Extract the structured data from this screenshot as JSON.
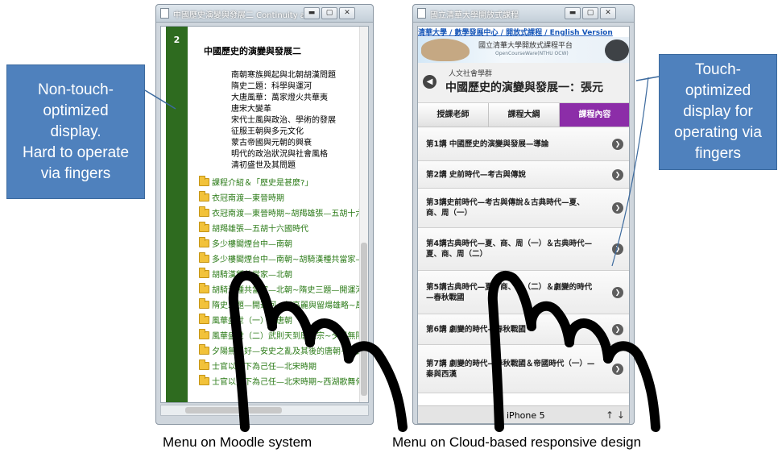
{
  "moodle_window": {
    "title": "中國歷史演變與發展二 Continuity an...",
    "topic_number": "2",
    "topic_title": "中國歷史的演變與發展二",
    "subtopics": [
      "南朝寒族興起與北朝胡漢問題",
      "隋史二題：科學與運河",
      "大唐風華：萬家燈火共華夷",
      "唐宋大變革",
      "宋代士風與政治、學術的發展",
      "征服王朝與多元文化",
      "蒙古帝國與元朝的興衰",
      "明代的政治狀況與社會風格",
      "清初盛世及其問題"
    ],
    "resources": [
      "課程介紹＆「歷史是甚麼?」",
      "衣冠南渡—東晉時期",
      "衣冠南渡—東晉時期~胡羯雄張—五胡十六國",
      "胡羯雄張—五胡十六國時代",
      "多少樓閣煙台中—南朝",
      "多少樓閣煙台中—南朝~胡騎漢種共當家—北",
      "胡騎漢種共當家—北朝",
      "胡騎漢種共當家—北朝~隋史三題—開運河、",
      "隋史三題—開運河、征高麗與留煬雄略~風華",
      "風華盛世（一）—唐朝",
      "風華盛世（二）武則天到唐玄宗~夕陽無限",
      "夕陽無限好—安史之亂及其後的唐朝~士官以",
      "士官以天下為己任—北宋時期",
      "士官以天下為己任—北宋時期~西湖歌舞何時"
    ]
  },
  "cloud_window": {
    "title": "國立清華大學開放式課程",
    "nav_links": "清華大學 / 數學發展中心 / 開放式課程 / English Version",
    "banner_text": "國立清華大學開放式課程平台",
    "banner_sub": "OpenCourseWare(NTHU OCW)",
    "category": "人文社會學群",
    "course_title": "中國歷史的演變與發展一：張元",
    "tabs": [
      {
        "label": "授課老師",
        "active": false
      },
      {
        "label": "課程大綱",
        "active": false
      },
      {
        "label": "課程內容",
        "active": true
      }
    ],
    "lessons": [
      "第1講 中國歷史的演變與發展—導論",
      "第2講 史前時代—考古與傳說",
      "第3講史前時代—考古與傳說＆古典時代—夏、商、周（一）",
      "第4講古典時代—夏、商、周（一）＆古典時代—夏、商、周（二）",
      "第5講古典時代—夏、商、周（二）＆劇變的時代—春秋戰國",
      "第6講 劇變的時代—春秋戰國",
      "第7講 劇變的時代—春秋戰國＆帝國時代（一）—秦與西漢"
    ],
    "device_label": "iPhone 5",
    "orientation_arrows": "↑ ↓"
  },
  "callouts": {
    "left": [
      "Non-touch-",
      "optimized",
      "display.",
      "Hard to operate",
      "via fingers"
    ],
    "right": [
      "Touch-",
      "optimized",
      "display for",
      "operating via",
      "fingers"
    ]
  },
  "captions": {
    "left": "Menu on Moodle system",
    "right": "Menu on Cloud-based responsive design"
  },
  "colors": {
    "callout_blue": "#4f81bd",
    "moodle_green": "#2e6b1f",
    "link_green": "#2a7a16",
    "active_tab_purple": "#8c2da8"
  }
}
